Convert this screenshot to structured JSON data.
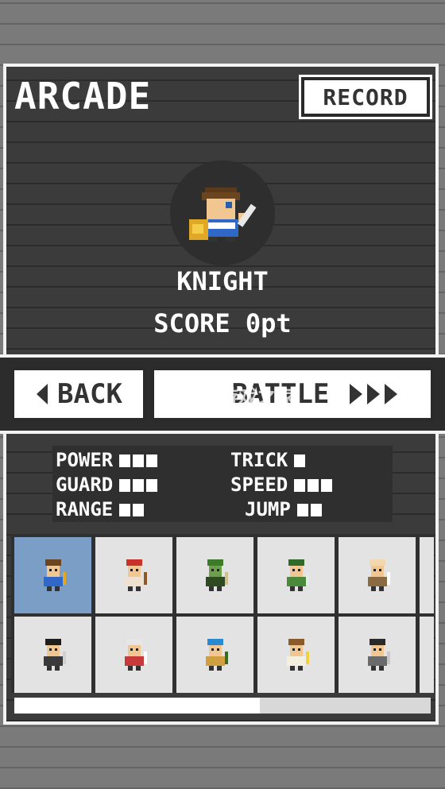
{
  "header": {
    "title": "ARCADE",
    "record_label": "RECORD"
  },
  "selected_character": {
    "name": "KNIGHT",
    "score_label": "SCORE",
    "score_value": "0pt"
  },
  "buttons": {
    "back_label": "BACK",
    "battle_label": "BATTLE"
  },
  "stats": [
    {
      "label": "POWER",
      "level": 3
    },
    {
      "label": "TRICK",
      "level": 1
    },
    {
      "label": "GUARD",
      "level": 3
    },
    {
      "label": "SPEED",
      "level": 3
    },
    {
      "label": "RANGE",
      "level": 2
    },
    {
      "label": "JUMP",
      "level": 2
    }
  ],
  "roster": [
    {
      "icon": "knight-icon",
      "selected": true
    },
    {
      "icon": "red-archer-icon"
    },
    {
      "icon": "green-goblin-icon"
    },
    {
      "icon": "green-elf-icon"
    },
    {
      "icon": "bald-monk-icon"
    },
    {
      "icon": "black-hair-swordsman-icon"
    },
    {
      "icon": "fox-mask-girl-icon"
    },
    {
      "icon": "blue-hair-fighter-icon"
    },
    {
      "icon": "angel-icon"
    },
    {
      "icon": "dark-warrior-icon"
    }
  ],
  "scroll_progress": 0.59,
  "watermark": "K73 游戏之家",
  "colors": {
    "selected_cell": "#7a9ec6",
    "panel": "#3b3b3b",
    "button": "#ffffff"
  }
}
